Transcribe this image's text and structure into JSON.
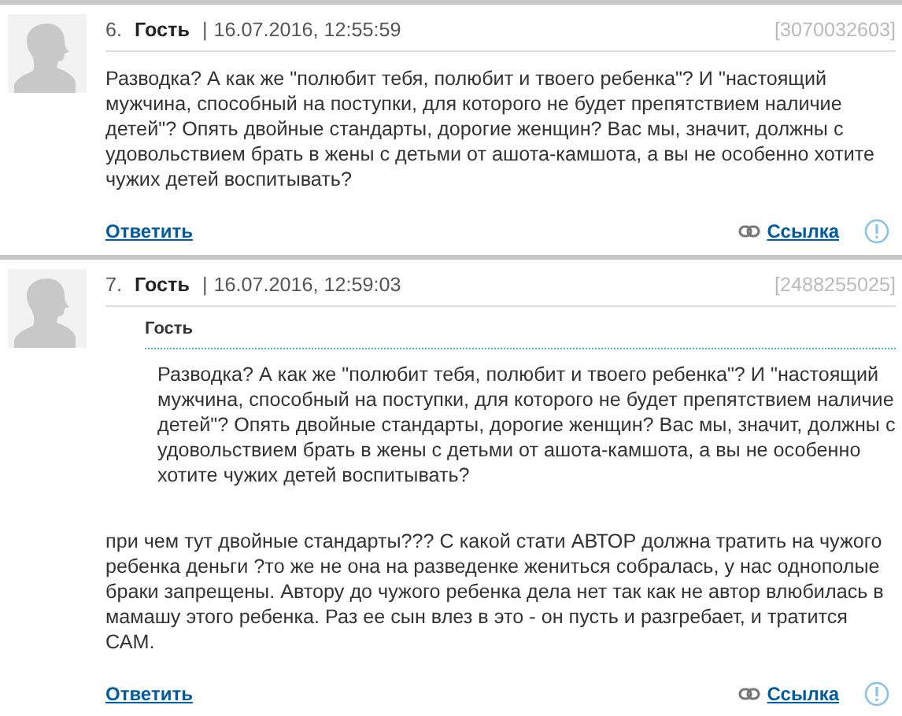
{
  "comments": [
    {
      "number": "6.",
      "author": "Гость",
      "separator": "|",
      "date": "16.07.2016, 12:55:59",
      "id": "[3070032603]",
      "text": "Разводка? А как же \"полюбит тебя, полюбит и твоего ребенка\"? И \"настоящий мужчина, способный на поступки, для которого не будет препятствием наличие детей\"? Опять двойные стандарты, дорогие женщин? Вас мы, значит, должны с удовольствием брать в жены с детьми от ашота-камшота, а вы не особенно хотите чужих детей воспитывать?",
      "reply": "Ответить",
      "link": "Ссылка"
    },
    {
      "number": "7.",
      "author": "Гость",
      "separator": "|",
      "date": "16.07.2016, 12:59:03",
      "id": "[2488255025]",
      "quote": {
        "author": "Гость",
        "text": "Разводка? А как же \"полюбит тебя, полюбит и твоего ребенка\"? И \"настоящий мужчина, способный на поступки, для которого не будет препятствием наличие детей\"? Опять двойные стандарты, дорогие женщин? Вас мы, значит, должны с удовольствием брать в жены с детьми от ашота-камшота, а вы не особенно хотите чужих детей воспитывать?"
      },
      "text": "при чем тут двойные стандарты??? С какой стати АВТОР должна тратить на чужого ребенка деньги ?то же не она на разведенке жениться собралась, у нас однополые браки запрещены. Автору до чужого ребенка дела нет так как не автор влюбилась в мамашу этого ребенка. Раз ее сын влез в это - он пусть и разгребает, и тратится САМ.",
      "reply": "Ответить",
      "link": "Ссылка"
    }
  ]
}
